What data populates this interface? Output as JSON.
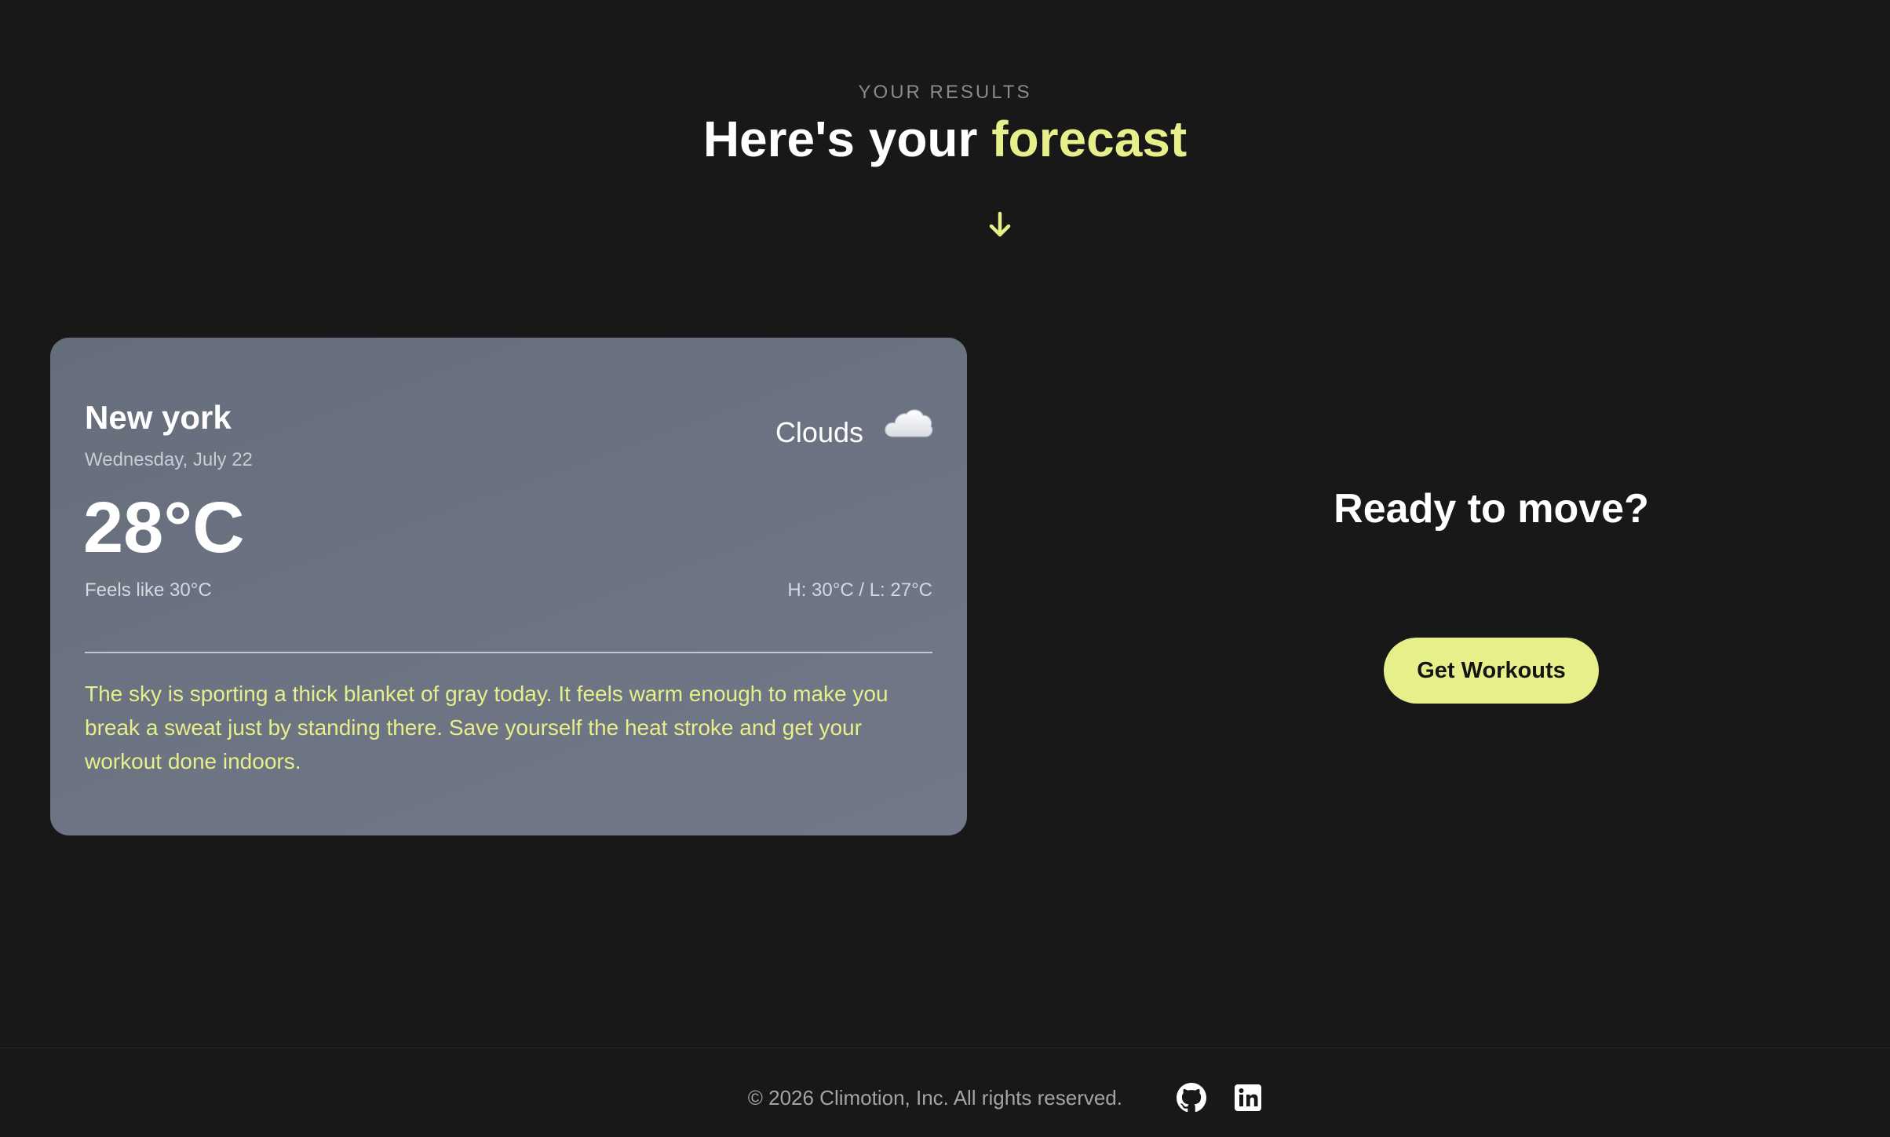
{
  "header": {
    "eyebrow": "YOUR RESULTS",
    "title_prefix": "Here's your ",
    "title_accent": "forecast",
    "scroll_icon": "arrow-down-icon"
  },
  "weather": {
    "city": "New york",
    "date": "Wednesday, July 22",
    "condition": "Clouds",
    "condition_icon": "cloud-icon",
    "temperature": "28°C",
    "feels_like": "Feels like 30°C",
    "high_low": "H: 30°C / L: 27°C",
    "description": "The sky is sporting a thick blanket of gray today. It feels warm enough to make you break a sweat just by standing there. Save yourself the heat stroke and get your workout done indoors."
  },
  "cta": {
    "title": "Ready to move?",
    "button_label": "Get Workouts"
  },
  "footer": {
    "copyright": "© 2026 Climotion, Inc. All rights reserved.",
    "links": [
      "github-icon",
      "linkedin-icon"
    ]
  },
  "colors": {
    "background": "#181818",
    "accent": "#e6ef8a",
    "card": "#6b7280",
    "muted_text": "#8a8a8a"
  }
}
